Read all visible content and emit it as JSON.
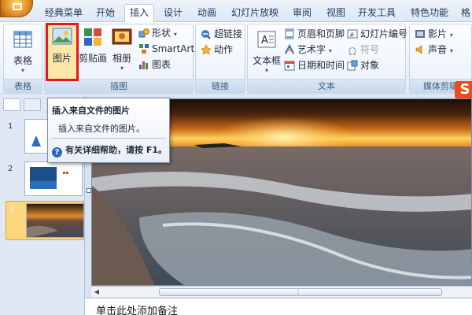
{
  "ribbon_tabs": [
    "经典菜单",
    "开始",
    "插入",
    "设计",
    "动画",
    "幻灯片放映",
    "审阅",
    "视图",
    "开发工具",
    "特色功能",
    "格"
  ],
  "active_tab": "插入",
  "groups": {
    "tables": {
      "label": "表格",
      "table_button": "表格"
    },
    "illustrations": {
      "label": "插图",
      "picture_button": "图片",
      "clipart_button": "剪贴画",
      "album_button": "相册",
      "shapes_button": "形状",
      "smartart_button": "SmartArt",
      "chart_button": "图表"
    },
    "links": {
      "label": "链接",
      "hyperlink_button": "超链接",
      "action_button": "动作"
    },
    "text": {
      "label": "文本",
      "textbox_button": "文本框",
      "header_footer_button": "页眉和页脚",
      "wordart_button": "艺术字",
      "datetime_button": "日期和时间",
      "slide_number_button": "幻灯片编号",
      "symbol_button": "符号",
      "object_button": "对象"
    },
    "media": {
      "label": "媒体剪辑",
      "movie_button": "影片",
      "sound_button": "声音"
    }
  },
  "tooltip": {
    "title": "插入来自文件的图片",
    "description": "插入来自文件的图片。",
    "help": "有关详细帮助，请按 F1。"
  },
  "slides": [
    {
      "number": "1"
    },
    {
      "number": "2"
    },
    {
      "number": "3"
    }
  ],
  "notes_placeholder": "单击此处添加备注",
  "logo_text": "S",
  "colors": {
    "highlight_frame": "#e8151b",
    "selected_slide": "#fbd67c",
    "ribbon_bg": "#eef4fb"
  }
}
